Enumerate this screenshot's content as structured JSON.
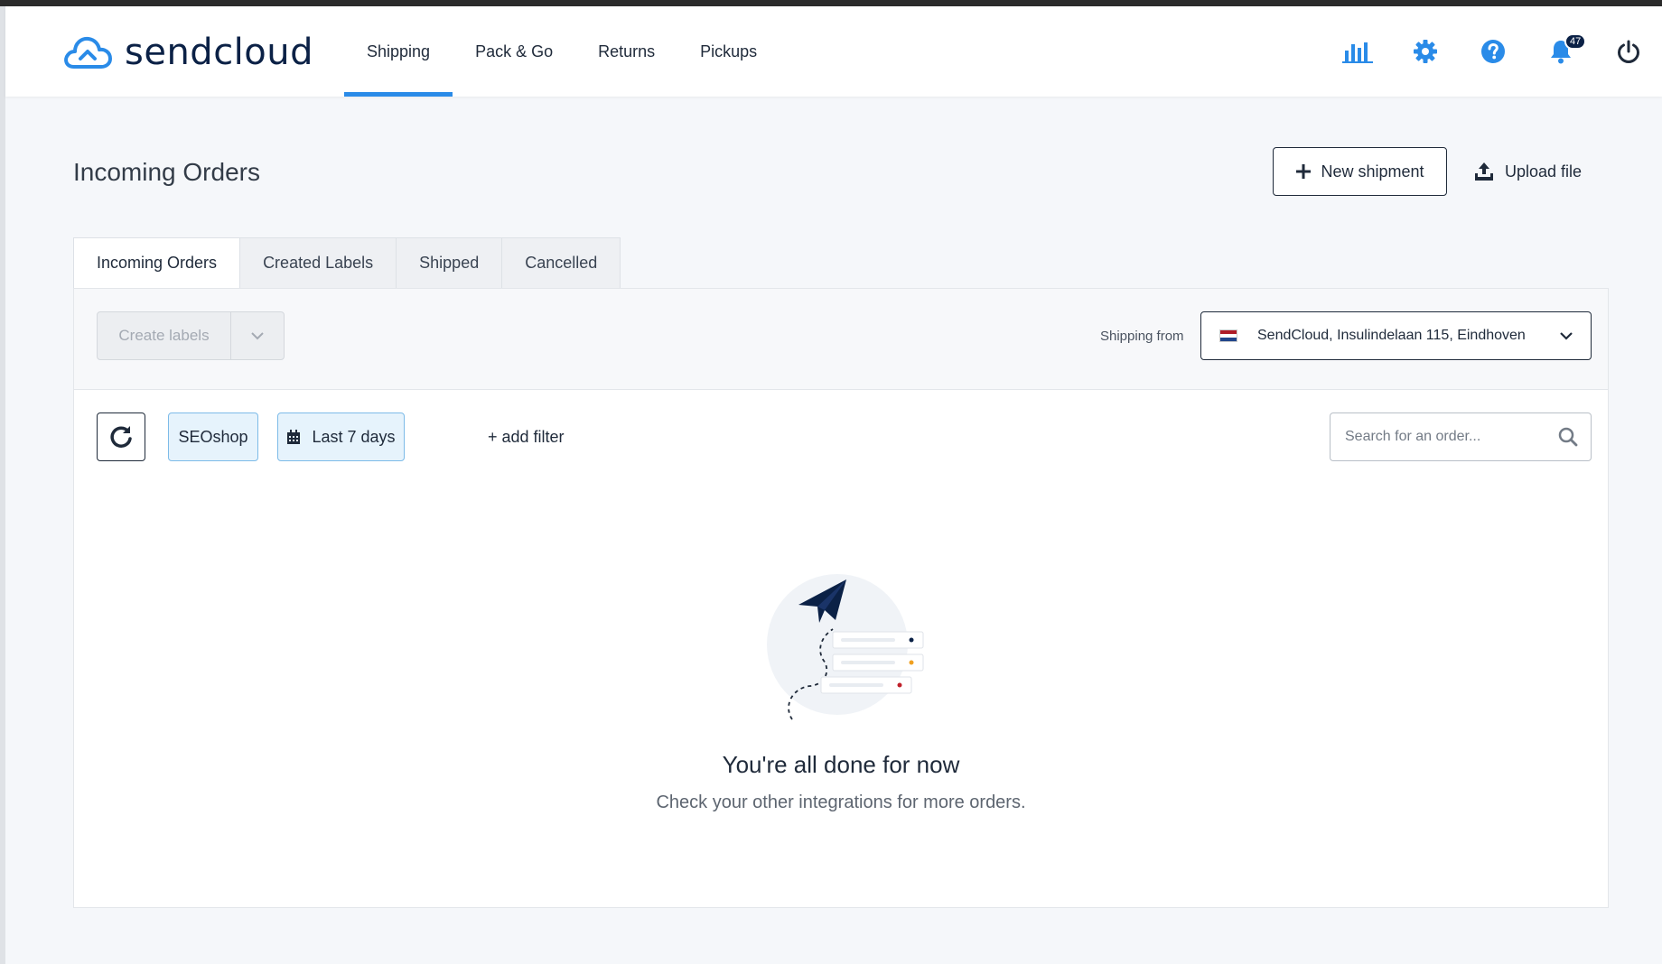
{
  "brand": {
    "name": "sendcloud",
    "accent": "#2a8be8",
    "navy": "#0b2146"
  },
  "nav": {
    "items": [
      {
        "label": "Shipping",
        "active": true
      },
      {
        "label": "Pack & Go"
      },
      {
        "label": "Returns"
      },
      {
        "label": "Pickups"
      }
    ]
  },
  "header_icons": {
    "analytics": "bar-chart-icon",
    "settings": "gear-icon",
    "help": "question-icon",
    "notifications": "bell-icon",
    "notifications_count": "47",
    "logout": "power-icon"
  },
  "page": {
    "title": "Incoming Orders",
    "new_shipment_label": "New shipment",
    "upload_file_label": "Upload file"
  },
  "tabs": [
    {
      "label": "Incoming Orders",
      "active": true
    },
    {
      "label": "Created Labels"
    },
    {
      "label": "Shipped"
    },
    {
      "label": "Cancelled"
    }
  ],
  "toolbar": {
    "create_labels": "Create labels",
    "shipping_from_label": "Shipping from",
    "shipping_from_value": "SendCloud, Insulindelaan 115, Eindhoven"
  },
  "filters": {
    "shop": "SEOshop",
    "date_range": "Last 7 days",
    "add_filter": "+ add filter",
    "search_placeholder": "Search for an order..."
  },
  "empty_state": {
    "title": "You're all done for now",
    "subtitle": "Check your other integrations for more orders."
  }
}
